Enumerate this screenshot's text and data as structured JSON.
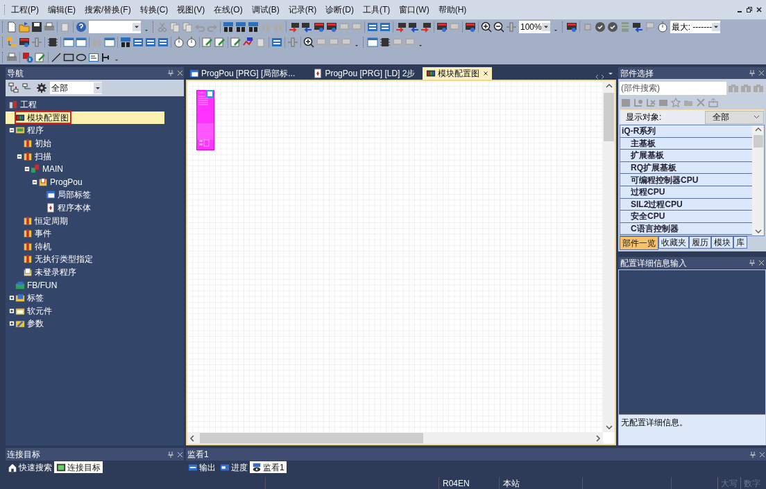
{
  "menu": {
    "items": [
      "工程(P)",
      "编辑(E)",
      "搜索/替换(F)",
      "转换(C)",
      "视图(V)",
      "在线(O)",
      "调试(B)",
      "记录(R)",
      "诊断(D)",
      "工具(T)",
      "窗口(W)",
      "帮助(H)"
    ]
  },
  "toolbar": {
    "zoom": "100%",
    "step_display": "最大: -------"
  },
  "navigation": {
    "title": "导航",
    "filter": "全部",
    "tree": [
      {
        "label": "工程",
        "kind": "project",
        "selected": false
      },
      {
        "label": "模块配置图",
        "kind": "layout",
        "selected": true
      },
      {
        "label": "程序",
        "kind": "program-folder",
        "selected": false,
        "expanded": true,
        "children": [
          {
            "label": "初始",
            "kind": "program-type",
            "selected": false
          },
          {
            "label": "扫描",
            "kind": "program-type",
            "selected": false,
            "expanded": true,
            "children": [
              {
                "label": "MAIN",
                "kind": "program",
                "selected": false,
                "expanded": true,
                "children": [
                  {
                    "label": "ProgPou",
                    "kind": "pou",
                    "selected": false,
                    "expanded": true,
                    "children": [
                      {
                        "label": "局部标签",
                        "kind": "labels",
                        "selected": false
                      },
                      {
                        "label": "程序本体",
                        "kind": "body",
                        "selected": false
                      }
                    ]
                  }
                ]
              }
            ]
          },
          {
            "label": "恒定周期",
            "kind": "program-type",
            "selected": false
          },
          {
            "label": "事件",
            "kind": "program-type",
            "selected": false
          },
          {
            "label": "待机",
            "kind": "program-type",
            "selected": false
          },
          {
            "label": "无执行类型指定",
            "kind": "program-type",
            "selected": false
          },
          {
            "label": "未登录程序",
            "kind": "unregistered",
            "selected": false
          }
        ]
      },
      {
        "label": "FB/FUN",
        "kind": "fbfun",
        "selected": false
      },
      {
        "label": "标签",
        "kind": "label-folder",
        "selected": false,
        "expanded": false
      },
      {
        "label": "软元件",
        "kind": "device",
        "selected": false,
        "expanded": false
      },
      {
        "label": "参数",
        "kind": "parameter",
        "selected": false,
        "expanded": false
      }
    ]
  },
  "editor_tabs": [
    {
      "label": "ProgPou [PRG] [局部标...",
      "kind": "labels",
      "selected": false
    },
    {
      "label": "ProgPou [PRG] [LD] 2步",
      "kind": "body",
      "selected": false
    },
    {
      "label": "模块配置图",
      "kind": "layout",
      "selected": true
    }
  ],
  "parts_selection": {
    "title": "部件选择",
    "search": {
      "placeholder": "(部件搜索)"
    },
    "display_label": "显示对象:",
    "display_value": "全部",
    "items": [
      {
        "label": "iQ-R系列",
        "kind": "group"
      },
      {
        "label": "主基板",
        "kind": "item"
      },
      {
        "label": "扩展基板",
        "kind": "item"
      },
      {
        "label": "RQ扩展基板",
        "kind": "item"
      },
      {
        "label": "可编程控制器CPU",
        "kind": "item"
      },
      {
        "label": "过程CPU",
        "kind": "item"
      },
      {
        "label": "SIL2过程CPU",
        "kind": "item"
      },
      {
        "label": "安全CPU",
        "kind": "item"
      },
      {
        "label": "C语言控制器",
        "kind": "item"
      }
    ],
    "tabs": [
      {
        "label": "部件一览",
        "selected": true
      },
      {
        "label": "收藏夹",
        "selected": false
      },
      {
        "label": "履历",
        "selected": false
      },
      {
        "label": "模块",
        "selected": false
      },
      {
        "label": "库",
        "selected": false
      }
    ]
  },
  "detail_panel": {
    "title": "配置详细信息输入",
    "message": "无配置详细信息。"
  },
  "connection_panel": {
    "title": "连接目标",
    "tabs": [
      {
        "label": "快速搜索",
        "kind": "search",
        "selected": false
      },
      {
        "label": "连接目标",
        "kind": "connection",
        "selected": true
      }
    ]
  },
  "watch_panel": {
    "title": "监看1",
    "tabs": [
      {
        "label": "输出",
        "kind": "output",
        "selected": false
      },
      {
        "label": "进度",
        "kind": "progress",
        "selected": false
      },
      {
        "label": "监看1",
        "kind": "watch",
        "selected": true
      }
    ]
  },
  "status_bar": {
    "cpu": "R04EN",
    "station": "本站",
    "indicators": [
      {
        "label": "大写",
        "on": false
      },
      {
        "label": "数字",
        "on": false
      }
    ]
  }
}
